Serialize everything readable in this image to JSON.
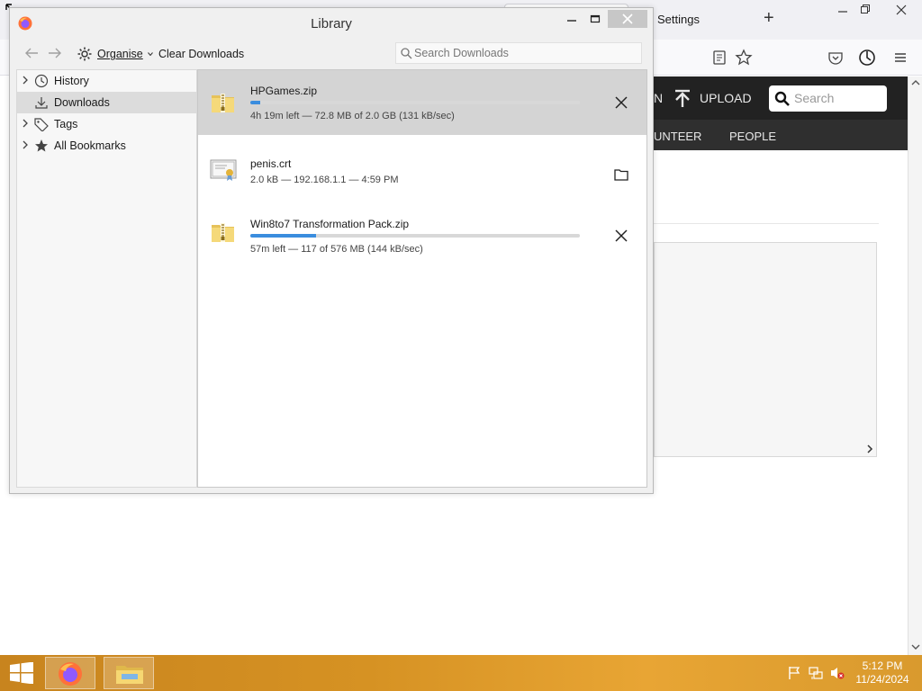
{
  "browser": {
    "settings_tab_label": "Settings",
    "new_tab": "+",
    "upload_label": "UPLOAD",
    "partial_label_1": "N",
    "search_placeholder": "Search",
    "nav_partial": "UNTEER",
    "nav_people": "PEOPLE"
  },
  "library": {
    "title": "Library",
    "toolbar": {
      "organise_label": "Organise",
      "clear_downloads_label": "Clear Downloads",
      "search_placeholder": "Search Downloads"
    },
    "sidebar": {
      "items": [
        {
          "label": "History",
          "icon": "clock-icon",
          "expandable": true,
          "selected": false
        },
        {
          "label": "Downloads",
          "icon": "download-icon",
          "expandable": false,
          "selected": true
        },
        {
          "label": "Tags",
          "icon": "tag-icon",
          "expandable": true,
          "selected": false
        },
        {
          "label": "All Bookmarks",
          "icon": "star-icon",
          "expandable": true,
          "selected": false
        }
      ]
    },
    "downloads": [
      {
        "name": "HPGames.zip",
        "status": "4h 19m left — 72.8 MB of 2.0 GB (131 kB/sec)",
        "progress": 0.03,
        "action": "cancel-icon",
        "selected": true,
        "file_icon": "zip-folder-icon"
      },
      {
        "name": "penis.crt",
        "status": "2.0 kB — 192.168.1.1 — 4:59 PM",
        "progress": null,
        "action": "open-folder-icon",
        "selected": false,
        "file_icon": "certificate-icon"
      },
      {
        "name": "Win8to7 Transformation Pack.zip",
        "status": "57m left — 117 of 576 MB (144 kB/sec)",
        "progress": 0.2,
        "action": "cancel-icon",
        "selected": false,
        "file_icon": "zip-folder-icon"
      }
    ]
  },
  "taskbar": {
    "time": "5:12 PM",
    "date": "11/24/2024"
  },
  "colors": {
    "progress_fill": "#3a8dde",
    "selected_row": "#d4d4d4",
    "taskbar": "#d69223"
  }
}
